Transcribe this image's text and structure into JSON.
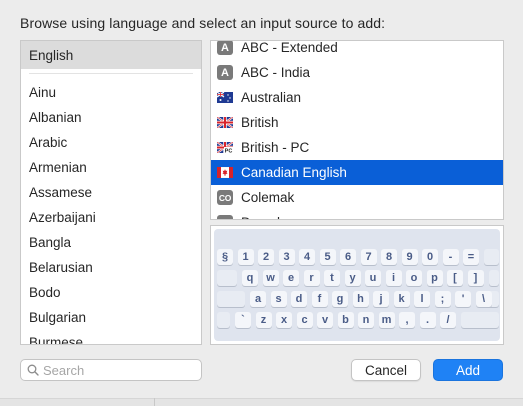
{
  "prompt": "Browse using language and select an input source to add:",
  "languages": {
    "selected": "English",
    "items": [
      "Ainu",
      "Albanian",
      "Arabic",
      "Armenian",
      "Assamese",
      "Azerbaijani",
      "Bangla",
      "Belarusian",
      "Bodo",
      "Bulgarian",
      "Burmese"
    ]
  },
  "sources": [
    {
      "label": "ABC - Extended",
      "icon": "letter-a-icon",
      "glyph": "A"
    },
    {
      "label": "ABC - India",
      "icon": "letter-a-icon",
      "glyph": "A"
    },
    {
      "label": "Australian",
      "icon": "australia-flag-icon",
      "glyph": ""
    },
    {
      "label": "British",
      "icon": "uk-flag-icon",
      "glyph": ""
    },
    {
      "label": "British - PC",
      "icon": "uk-pc-flag-icon",
      "glyph": "PC"
    },
    {
      "label": "Canadian English",
      "icon": "canada-flag-icon",
      "glyph": "",
      "selected": true
    },
    {
      "label": "Colemak",
      "icon": "colemak-icon",
      "glyph": "CO"
    },
    {
      "label": "Dvorak",
      "icon": "dvorak-icon",
      "glyph": "DV"
    }
  ],
  "keyboard": {
    "row1": [
      "§",
      "1",
      "2",
      "3",
      "4",
      "5",
      "6",
      "7",
      "8",
      "9",
      "0",
      "-",
      "="
    ],
    "row2": [
      "q",
      "w",
      "e",
      "r",
      "t",
      "y",
      "u",
      "i",
      "o",
      "p",
      "[",
      "]"
    ],
    "row3": [
      "a",
      "s",
      "d",
      "f",
      "g",
      "h",
      "j",
      "k",
      "l",
      ";",
      "'",
      "\\"
    ],
    "row4": [
      "`",
      "z",
      "x",
      "c",
      "v",
      "b",
      "n",
      "m",
      ",",
      ".",
      "/"
    ]
  },
  "search": {
    "placeholder": "Search"
  },
  "buttons": {
    "cancel": "Cancel",
    "add": "Add"
  },
  "colors": {
    "selection": "#0a5fd7",
    "add_button": "#1f82f5",
    "keyboard_text": "#4a5c87"
  }
}
